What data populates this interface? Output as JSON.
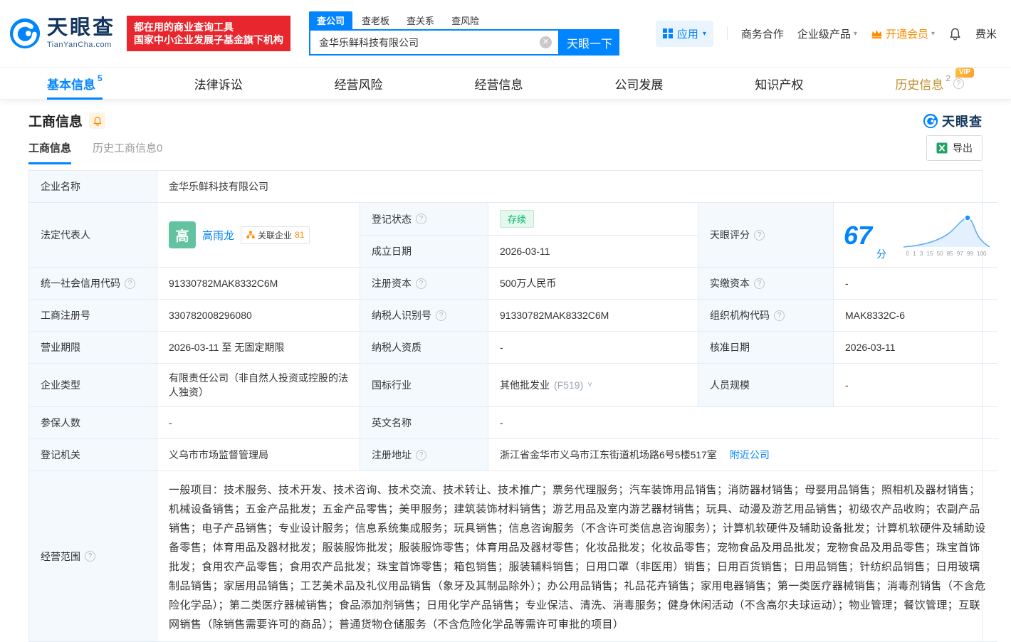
{
  "colors": {
    "brand_blue": "#0084ff",
    "brand_red": "#e8262d",
    "vip_orange": "#ff8a00",
    "status_green": "#00b365",
    "label_bg": "#f4f9fe"
  },
  "icons": {
    "help": "?",
    "caret": "▾",
    "clear": "✕",
    "chevron_down": "˅"
  },
  "header": {
    "logo": {
      "name": "天眼查",
      "domain": "TianYanCha.com"
    },
    "slogan": {
      "line1": "都在用的商业查询工具",
      "line2": "国家中小企业发展子基金旗下机构"
    },
    "search": {
      "tabs": [
        {
          "label": "查公司"
        },
        {
          "label": "查老板"
        },
        {
          "label": "查关系"
        },
        {
          "label": "查风险"
        }
      ],
      "value": "金华乐鲜科技有限公司",
      "button": "天眼一下"
    },
    "menu": {
      "apps": "应用",
      "cooperation": "商务合作",
      "enterprise": "企业级产品",
      "vip": "开通会员",
      "user": "费米"
    }
  },
  "nav": {
    "tabs": [
      {
        "label": "基本信息",
        "badge": "5"
      },
      {
        "label": "法律诉讼"
      },
      {
        "label": "经营风险"
      },
      {
        "label": "经营信息"
      },
      {
        "label": "公司发展"
      },
      {
        "label": "知识产权"
      },
      {
        "label": "历史信息",
        "badge": "2",
        "tag": "VIP"
      }
    ]
  },
  "section": {
    "title": "工商信息",
    "subtabs": [
      {
        "label": "工商信息"
      },
      {
        "label": "历史工商信息0"
      }
    ],
    "export": "导出",
    "brand": "天眼查"
  },
  "table": {
    "company_name": {
      "label": "企业名称",
      "value": "金华乐鲜科技有限公司"
    },
    "legal_rep": {
      "label": "法定代表人",
      "avatar": "高",
      "name": "高雨龙",
      "related_label": "关联企业",
      "related_count": "81"
    },
    "reg_status": {
      "label": "登记状态",
      "value": "存续"
    },
    "establish_date": {
      "label": "成立日期",
      "value": "2026-03-11"
    },
    "score": {
      "label": "天眼评分",
      "value": "67",
      "unit": "分",
      "axis": "0 1 3 15 50 85 97 99 100"
    },
    "uscc": {
      "label": "统一社会信用代码",
      "value": "91330782MAK8332C6M"
    },
    "reg_capital": {
      "label": "注册资本",
      "value": "500万人民币"
    },
    "paid_capital": {
      "label": "实缴资本",
      "value": "-"
    },
    "reg_number": {
      "label": "工商注册号",
      "value": "330782008296080"
    },
    "taxpayer_id": {
      "label": "纳税人识别号",
      "value": "91330782MAK8332C6M"
    },
    "org_code": {
      "label": "组织机构代码",
      "value": "MAK8332C-6"
    },
    "business_term": {
      "label": "营业期限",
      "value": "2026-03-11 至 无固定期限"
    },
    "taxpayer_quality": {
      "label": "纳税人资质",
      "value": "-"
    },
    "approval_date": {
      "label": "核准日期",
      "value": "2026-03-11"
    },
    "company_type": {
      "label": "企业类型",
      "value": "有限责任公司（非自然人投资或控股的法人独资）"
    },
    "industry": {
      "label": "国标行业",
      "value": "其他批发业",
      "code": "(F519)"
    },
    "staff_size": {
      "label": "人员规模",
      "value": "-"
    },
    "insured_count": {
      "label": "参保人数",
      "value": "-"
    },
    "english_name": {
      "label": "英文名称",
      "value": "-"
    },
    "reg_authority": {
      "label": "登记机关",
      "value": "义乌市市场监督管理局"
    },
    "address": {
      "label": "注册地址",
      "value": "浙江省金华市义乌市江东街道机场路6号5楼517室",
      "nearby": "附近公司"
    },
    "scope": {
      "label": "经营范围",
      "value": "一般项目：技术服务、技术开发、技术咨询、技术交流、技术转让、技术推广；票务代理服务；汽车装饰用品销售；消防器材销售；母婴用品销售；照相机及器材销售；机械设备销售；五金产品批发；五金产品零售；美甲服务；建筑装饰材料销售；游艺用品及室内游艺器材销售；玩具、动漫及游艺用品销售；初级农产品收购；农副产品销售；电子产品销售；专业设计服务；信息系统集成服务；玩具销售；信息咨询服务（不含许可类信息咨询服务）；计算机软硬件及辅助设备批发；计算机软硬件及辅助设备零售；体育用品及器材批发；服装服饰批发；服装服饰零售；体育用品及器材零售；化妆品批发；化妆品零售；宠物食品及用品批发；宠物食品及用品零售；珠宝首饰批发；食用农产品零售；食用农产品批发；珠宝首饰零售；箱包销售；服装辅料销售；日用口罩（非医用）销售；日用百货销售；日用品销售；针纺织品销售；日用玻璃制品销售；家居用品销售；工艺美术品及礼仪用品销售（象牙及其制品除外）；办公用品销售；礼品花卉销售；家用电器销售；第一类医疗器械销售；消毒剂销售（不含危险化学品）；第二类医疗器械销售；食品添加剂销售；日用化学产品销售；专业保洁、清洗、消毒服务；健身休闲活动（不含高尔夫球运动）；物业管理；餐饮管理；互联网销售（除销售需要许可的商品）；普通货物仓储服务（不含危险化学品等需许可审批的项目）"
    }
  }
}
